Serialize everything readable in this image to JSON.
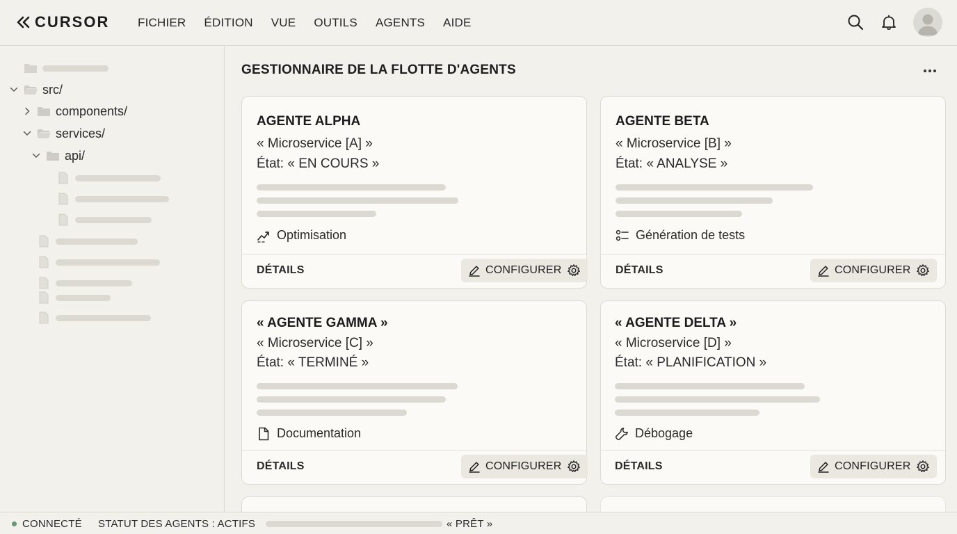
{
  "app": {
    "logo_text": "CURSOR",
    "menu": [
      "FICHIER",
      "ÉDITION",
      "VUE",
      "OUTILS",
      "AGENTS",
      "AIDE"
    ],
    "header_icons": [
      "search-icon",
      "bell-icon",
      "avatar"
    ]
  },
  "sidebar": {
    "src_folder": "src/",
    "components_folder": "components/",
    "services_folder": "services/",
    "api_folder": "api/"
  },
  "main": {
    "title": "GESTIONNAIRE DE LA FLOTTE D'AGENTS",
    "cards": [
      {
        "title": "AGENTE ALPHA",
        "service": "« Microservice [A] »",
        "state": "État: « EN COURS »",
        "tag": "Optimisation",
        "tag_icon": "trending-up-icon",
        "details_label": "DÉTAILS",
        "configure_label": "CONFIGURER"
      },
      {
        "title": "AGENTE BETA",
        "service": "« Microservice [B] »",
        "state": "État: « ANALYSE »",
        "tag": "Génération de tests",
        "tag_icon": "list-icon",
        "details_label": "DÉTAILS",
        "configure_label": "CONFIGURER"
      },
      {
        "title": "« AGENTE GAMMA »",
        "service": "« Microservice [C] »",
        "state": "État: « TERMINÉ »",
        "tag": "Documentation",
        "tag_icon": "document-icon",
        "details_label": "DÉTAILS",
        "configure_label": "CONFIGURER"
      },
      {
        "title": "« AGENTE DELTA »",
        "service": "« Microservice [D] »",
        "state": "État: « PLANIFICATION »",
        "tag": "Débogage",
        "tag_icon": "wrench-icon",
        "details_label": "DÉTAILS",
        "configure_label": "CONFIGURER"
      }
    ]
  },
  "statusbar": {
    "connection": "CONNECTÉ",
    "agents_status": "STATUT DES AGENTS : ACTIFS",
    "ready": "« PRÊT »"
  },
  "colors": {
    "background": "#f3f1ec",
    "card": "#fbfaf7",
    "border": "#dedad3",
    "placeholder": "#dcd9d3",
    "status_ok": "#5f9a6f"
  }
}
